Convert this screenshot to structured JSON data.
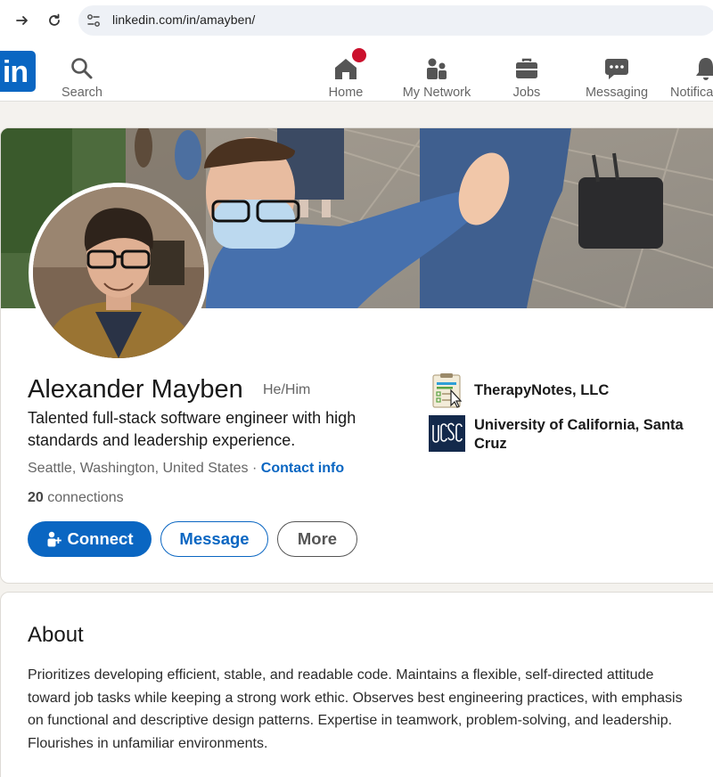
{
  "browser": {
    "url": "linkedin.com/in/amayben/"
  },
  "nav": {
    "logo_text": "in",
    "items": [
      {
        "label": "Search",
        "icon": "search-icon"
      },
      {
        "label": "Home",
        "icon": "home-icon"
      },
      {
        "label": "My Network",
        "icon": "network-icon"
      },
      {
        "label": "Jobs",
        "icon": "briefcase-icon"
      },
      {
        "label": "Messaging",
        "icon": "messaging-icon"
      },
      {
        "label": "Notifica",
        "icon": "bell-icon"
      }
    ]
  },
  "profile": {
    "name": "Alexander Mayben",
    "pronouns": "He/Him",
    "headline": "Talented full-stack software engineer with high standards and leadership experience.",
    "location": "Seattle, Washington, United States",
    "separator": " · ",
    "contact_info": "Contact info",
    "connections_count": "20",
    "connections_label": " connections",
    "buttons": {
      "connect": "Connect",
      "message": "Message",
      "more": "More"
    },
    "experience": [
      {
        "name": "TherapyNotes, LLC",
        "logo_text": "Therapy Notes"
      },
      {
        "name": "University of California, Santa Cruz",
        "logo_text": "UCSC"
      }
    ]
  },
  "about": {
    "title": "About",
    "text": "Prioritizes developing efficient, stable, and readable code. Maintains a flexible, self-directed attitude toward job tasks while keeping a strong work ethic. Observes best engineering practices, with emphasis on functional and descriptive design patterns. Expertise in teamwork, problem-solving, and leadership. Flourishes in unfamiliar environments."
  },
  "colors": {
    "brand": "#0a66c2",
    "badge": "#cb112d",
    "page_bg": "#f4f2ee"
  }
}
